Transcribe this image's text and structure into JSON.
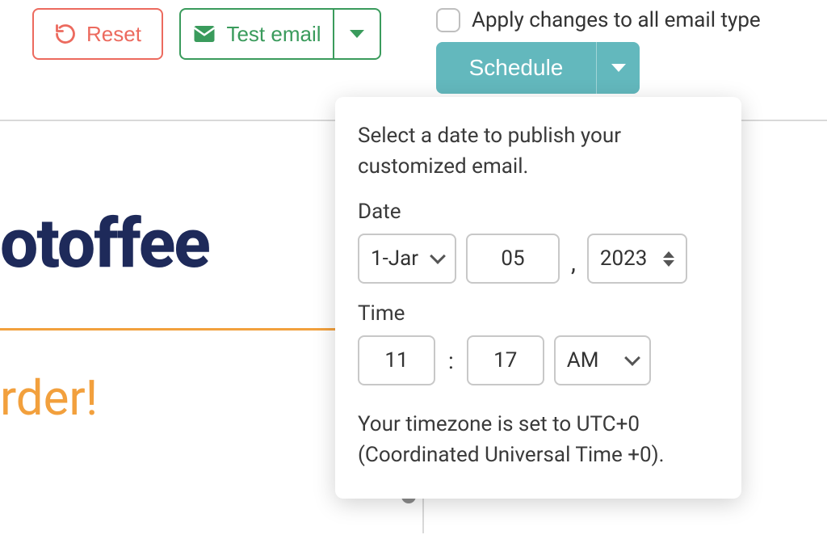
{
  "toolbar": {
    "reset_label": "Reset",
    "test_email_label": "Test email",
    "schedule_label": "Schedule"
  },
  "apply_label": "Apply changes to all email type",
  "popover": {
    "intro": "Select a date to publish your customized email.",
    "date_label": "Date",
    "date_picker": {
      "month_day": "1-Jar",
      "day": "05",
      "year": "2023"
    },
    "time_label": "Time",
    "time_picker": {
      "hour": "11",
      "minute": "17",
      "ampm": "AM"
    },
    "timezone": "Your timezone is set to UTC+0 (Coordinated Universal Time +0)."
  },
  "preview": {
    "brand_fragment": "otoffee",
    "order_fragment": "rder!"
  }
}
